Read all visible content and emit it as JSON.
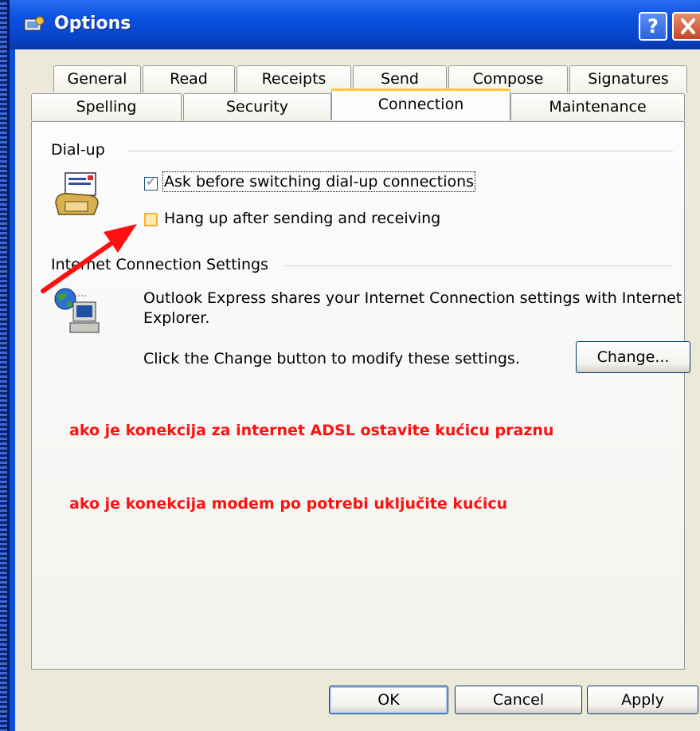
{
  "window": {
    "title": "Options"
  },
  "tabs_row1": [
    "General",
    "Read",
    "Receipts",
    "Send",
    "Compose",
    "Signatures"
  ],
  "tabs_row2": [
    "Spelling",
    "Security",
    "Connection",
    "Maintenance"
  ],
  "active_tab": "Connection",
  "dialup": {
    "label": "Dial-up",
    "ask_before_switching": {
      "label": "Ask before switching dial-up connections",
      "checked": true
    },
    "hang_up": {
      "label": "Hang up after sending and receiving",
      "checked": false
    }
  },
  "internet": {
    "label": "Internet Connection Settings",
    "description_line1": "Outlook Express shares your Internet Connection settings with Internet",
    "description_line2": "Explorer.",
    "change_hint": "Click the Change button to modify these settings.",
    "change_button": "Change..."
  },
  "annotations": {
    "line1": "ako je konekcija za internet ADSL ostavite kućicu praznu",
    "line2": "ako je konekcija modem po potrebi uključite kućicu",
    "color": "#ff1010"
  },
  "buttons": {
    "ok": "OK",
    "cancel": "Cancel",
    "apply": "Apply"
  },
  "icons": {
    "title": "options-icon",
    "dialup": "phone-icon",
    "internet": "globe-computer-icon"
  }
}
